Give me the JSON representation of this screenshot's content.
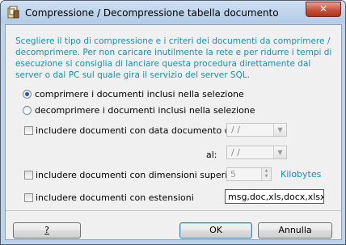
{
  "window": {
    "title": "Compressione / Decompressione tabella documento",
    "close_symbol": "✕",
    "app_icon": "document-compress-icon"
  },
  "description": "Scegliere il tipo di compressione e i criteri dei documenti da comprimere / decomprimere. Per non caricare inutilmente la rete e per ridurre i tempi di esecuzione si consiglia di lanciare questa procedura direttamente dal server o dal PC sul quale gira il servizio del server SQL.",
  "options": {
    "compress_label": "comprimere i documenti inclusi nella selezione",
    "compress_selected": true,
    "decompress_label": "decomprimere i documenti inclusi nella selezione",
    "decompress_selected": false
  },
  "filters": {
    "date_label": "includere documenti con data documento dal:",
    "date_checked": false,
    "date_from": "/ /",
    "date_to_label": "al:",
    "date_to": "/ /",
    "size_label": "includere documenti con dimensioni superiori a",
    "size_checked": false,
    "size_value": "5",
    "size_unit": "Kilobytes",
    "ext_label": "includere documenti con estensioni",
    "ext_checked": false,
    "ext_value": "msg,doc,xls,docx,xlsx"
  },
  "buttons": {
    "help_label": "?",
    "ok_label": "OK",
    "cancel_label": "Annulla"
  },
  "colors": {
    "description_text": "#1a8fb0",
    "close_button": "#c5523a"
  }
}
